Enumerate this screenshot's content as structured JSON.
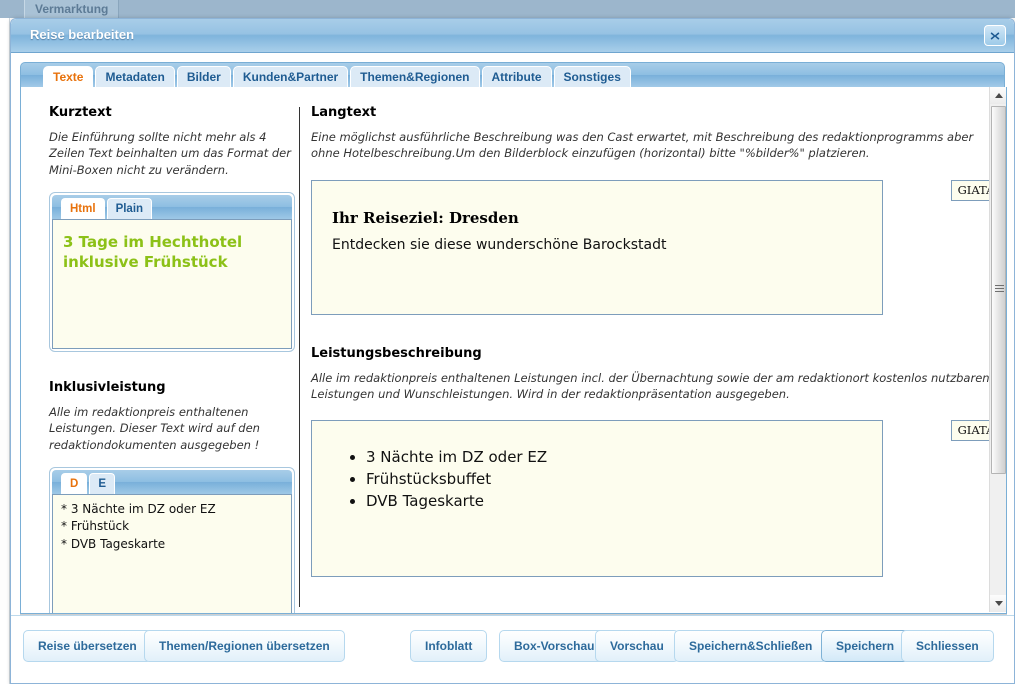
{
  "background": {
    "tab_label": "Vermarktung"
  },
  "window": {
    "title": "Reise bearbeiten",
    "close_icon": "close-icon"
  },
  "tabs": [
    {
      "label": "Texte",
      "active": true
    },
    {
      "label": "Metadaten",
      "active": false
    },
    {
      "label": "Bilder",
      "active": false
    },
    {
      "label": "Kunden&Partner",
      "active": false
    },
    {
      "label": "Themen&Regionen",
      "active": false
    },
    {
      "label": "Attribute",
      "active": false
    },
    {
      "label": "Sonstiges",
      "active": false
    }
  ],
  "left_column": {
    "kurztext": {
      "title": "Kurztext",
      "hint": "Die Einführung sollte nicht mehr als 4 Zeilen Text beinhalten um das Format der Mini-Boxen nicht zu verändern.",
      "editor_tabs": [
        {
          "label": "Html",
          "active": true
        },
        {
          "label": "Plain",
          "active": false
        }
      ],
      "content_line1": "3 Tage im Hechthotel",
      "content_line2": "inklusive Frühstück",
      "content_color": "#8cc117"
    },
    "inklusivleistung": {
      "title": "Inklusivleistung",
      "hint": "Alle im redaktionpreis enthaltenen Leistungen. Dieser Text wird auf den redaktiondokumenten ausgegeben !",
      "lang_tabs": [
        {
          "label": "D",
          "active": true
        },
        {
          "label": "E",
          "active": false
        }
      ],
      "textarea_value": "* 3 Nächte im DZ oder EZ\n* Frühstück\n* DVB Tageskarte"
    }
  },
  "right_column": {
    "langtext": {
      "title": "Langtext",
      "hint": "Eine möglichst ausführliche Beschreibung was den Cast erwartet, mit Beschreibung des redaktionprogramms aber ohne Hotelbeschreibung.Um den Bilderblock einzufügen (horizontal) bitte \"%bilder%\" platzieren.",
      "giata_label": "GIATA",
      "heading": "Ihr Reiseziel: Dresden",
      "body": "Entdecken sie diese wunderschöne Barockstadt"
    },
    "leistungsbeschreibung": {
      "title": "Leistungsbeschreibung",
      "hint": "Alle im redaktionpreis enthaltenen Leistungen incl. der Übernachtung sowie der am redaktionort kostenlos nutzbaren Leistungen und Wunschleistungen. Wird in der redaktionpräsentation ausgegeben.",
      "giata_label": "GIATA",
      "items": [
        "3 Nächte im DZ oder EZ",
        "Frühstücksbuffet",
        "DVB Tageskarte"
      ]
    }
  },
  "footer": {
    "buttons": [
      {
        "label": "Reise übersetzen",
        "focused": false
      },
      {
        "label": "Themen/Regionen übersetzen",
        "focused": false
      },
      {
        "label": "Infoblatt",
        "focused": false
      },
      {
        "label": "Box-Vorschau",
        "focused": false
      },
      {
        "label": "Vorschau",
        "focused": false
      },
      {
        "label": "Speichern&Schließen",
        "focused": false
      },
      {
        "label": "Speichern",
        "focused": true
      },
      {
        "label": "Schliessen",
        "focused": false
      }
    ]
  },
  "scrollbars": {
    "vertical_position": "top",
    "horizontal_position": "center"
  }
}
